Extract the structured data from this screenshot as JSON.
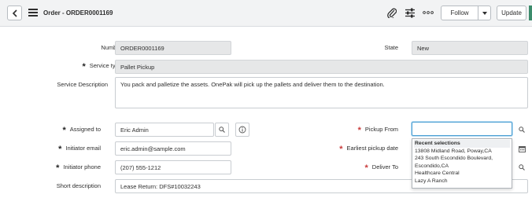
{
  "header": {
    "title": "Order - ORDER0001169",
    "follow_label": "Follow",
    "update_label": "Update"
  },
  "form": {
    "number": {
      "label": "Number",
      "value": "ORDER0001169"
    },
    "state": {
      "label": "State",
      "value": "New"
    },
    "service_type": {
      "label": "Service type",
      "value": "Pallet Pickup"
    },
    "service_description": {
      "label": "Service Description",
      "value": "You pack and palletize the assets.  OnePak will pick up the pallets and deliver them to the destination."
    },
    "assigned_to": {
      "label": "Assigned to",
      "value": "Eric Admin"
    },
    "initiator_email": {
      "label": "Initiator email",
      "value": "eric.admin@sample.com"
    },
    "initiator_phone": {
      "label": "Initiator phone",
      "value": "(207) 555-1212"
    },
    "short_description": {
      "label": "Short description",
      "value": "Lease Return: DFS#10032243"
    },
    "pickup_from": {
      "label": "Pickup From",
      "value": ""
    },
    "earliest_pickup_date": {
      "label": "Earliest pickup date",
      "value": ""
    },
    "deliver_to": {
      "label": "Deliver To",
      "value": ""
    }
  },
  "recent_selections": {
    "header": "Recent selections",
    "items": [
      "13808 Midland Road, Poway,CA",
      "243 South Escondido Boulevard,",
      "Escondido,CA",
      "Healthcare Central",
      "Lazy A Ranch"
    ]
  },
  "icons": [
    "chevron-left-icon",
    "hamburger-menu-icon",
    "paperclip-icon",
    "sliders-icon",
    "more-icon",
    "chevron-down-icon",
    "search-icon",
    "info-icon",
    "calendar-icon"
  ],
  "colors": {
    "required_red": "#c93b3b",
    "focus_blue": "#4a9fd3",
    "header_bg": "#f2f3f4",
    "readonly_bg": "#e6e7e8"
  }
}
